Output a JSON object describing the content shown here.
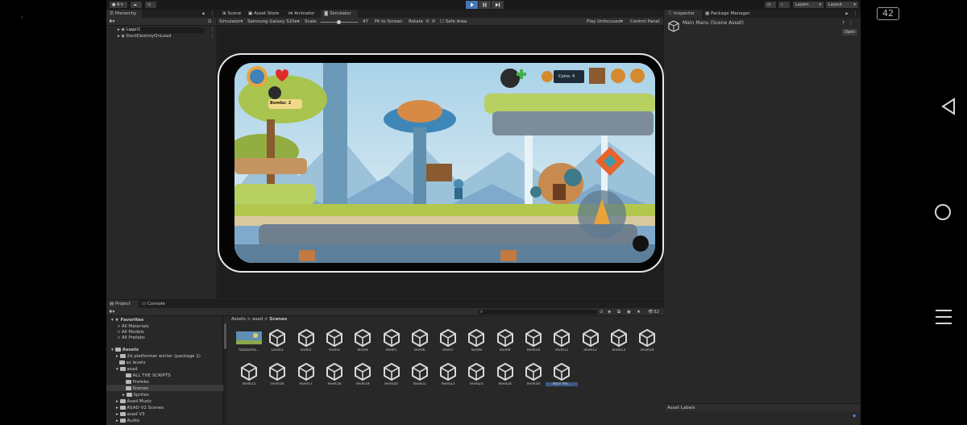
{
  "android": {
    "fps": "42"
  },
  "toolbar": {
    "account_label": "A",
    "layers_label": "Layers",
    "layout_label": "Layout"
  },
  "hierarchy": {
    "tab": "Hierarchy",
    "search_placeholder": "All",
    "items": [
      "Level1",
      "DontDestroyOnLoad"
    ]
  },
  "center_tabs": [
    "Scene",
    "Asset Store",
    "Animator",
    "Simulator"
  ],
  "simulator_toolbar": {
    "mode": "Simulator",
    "device": "Samsung Galaxy S10e",
    "scale_label": "Scale",
    "scale_value": "47",
    "fit": "Fit to Screen",
    "rotate": "Rotate",
    "safe_area": "Safe Area",
    "play_focus": "Play Unfocused",
    "control_panel": "Control Panel"
  },
  "game": {
    "coins_label": "Coins: 4",
    "bombs_label": "Bombs: 2"
  },
  "inspector": {
    "tabs": [
      "Inspector",
      "Package Manager"
    ],
    "asset_title": "Main Manu (Scene Asset)",
    "open_button": "Open",
    "asset_labels": "Asset Labels"
  },
  "project": {
    "tabs": [
      "Project",
      "Console"
    ],
    "icon_count": "32",
    "breadcrumb": [
      "Assets",
      "asad",
      "Scenes"
    ],
    "favorites": {
      "title": "Favorites",
      "items": [
        "All Materials",
        "All Models",
        "All Prefabs"
      ]
    },
    "assets_tree": {
      "title": "Assets",
      "items": [
        {
          "label": "2d platformer winter (package 1)",
          "indent": 1
        },
        {
          "label": "as levels",
          "indent": 1
        },
        {
          "label": "asad",
          "indent": 1
        },
        {
          "label": "ALL THE SCRIPTS",
          "indent": 2
        },
        {
          "label": "Prefebs",
          "indent": 2
        },
        {
          "label": "Scenes",
          "indent": 2
        },
        {
          "label": "Sprites",
          "indent": 2
        },
        {
          "label": "Asad Music",
          "indent": 1
        },
        {
          "label": "ASAD V2 Scenes",
          "indent": 1
        },
        {
          "label": "asad V3",
          "indent": 1
        },
        {
          "label": "Audio",
          "indent": 1
        }
      ]
    },
    "grid_row1": [
      "fantasmo...",
      "Level1",
      "level2",
      "level3",
      "level4",
      "level5",
      "level6",
      "level7",
      "level8",
      "level9",
      "level10",
      "level11",
      "level12",
      "level13",
      "level14"
    ],
    "grid_row2": [
      "level15",
      "level16",
      "level17",
      "level18",
      "level19",
      "level20",
      "level21",
      "level22",
      "level23",
      "level24",
      "level50",
      "Main Ma..."
    ]
  }
}
